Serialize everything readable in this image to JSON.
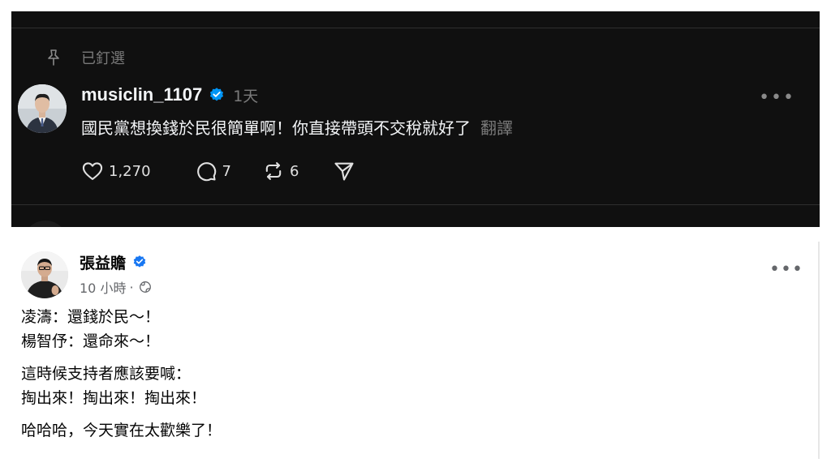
{
  "threads": {
    "pinned_label": "已釘選",
    "username": "musiclin_1107",
    "time": "1天",
    "content": "國民黨想換錢於民很簡單啊！你直接帶頭不交稅就好了",
    "translate": "翻譯",
    "more": "•••",
    "likes": "1,270",
    "replies": "7",
    "reposts": "6",
    "icons": [
      "pin-icon",
      "verified-badge-icon",
      "heart-icon",
      "comment-icon",
      "repost-icon",
      "share-icon"
    ],
    "colors": {
      "background": "#101010",
      "verified": "#0095f6",
      "text": "#f3f5f7",
      "muted": "#7a7a7a"
    }
  },
  "facebook": {
    "author": "張益贍",
    "time": "10 小時",
    "separator": "·",
    "more": "•••",
    "lines": [
      "凌濤：還錢於民～！",
      "楊智伃：還命來～！",
      "這時候支持者應該要喊：",
      "掏出來！掏出來！掏出來！",
      "哈哈哈，今天實在太歡樂了！"
    ],
    "icons": [
      "verified-badge-icon",
      "globe-icon"
    ],
    "colors": {
      "verified": "#1877f2",
      "text": "#050505",
      "muted": "#65676b"
    }
  }
}
